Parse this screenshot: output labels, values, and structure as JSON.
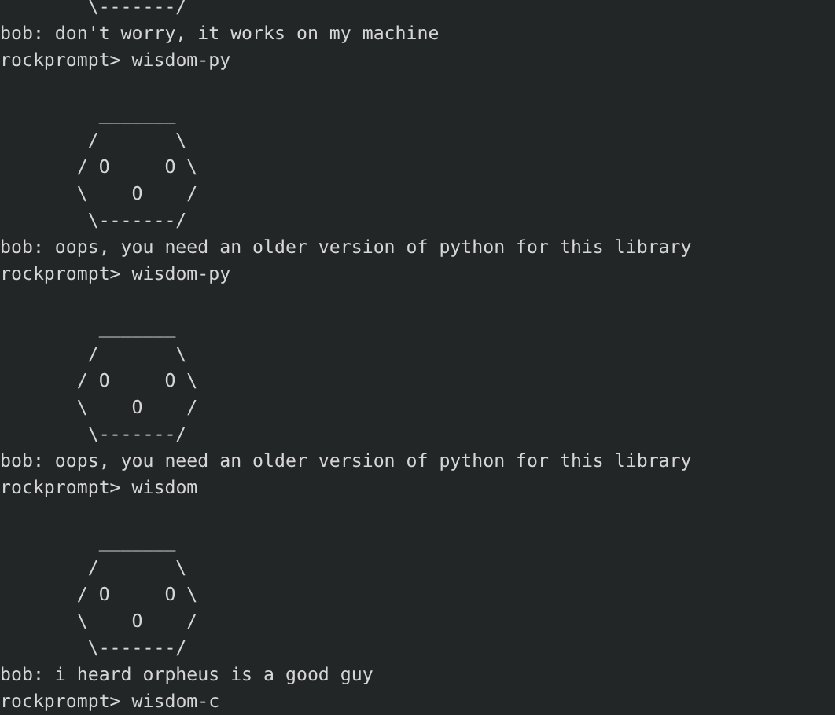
{
  "terminal": {
    "lines": [
      {
        "kind": "art",
        "lines": [
          "        \\-------/"
        ]
      },
      {
        "kind": "output",
        "text": "bob: don't worry, it works on my machine"
      },
      {
        "kind": "prompt",
        "prompt": "rockprompt>",
        "command": "wisdom-py"
      },
      {
        "kind": "blank"
      },
      {
        "kind": "art",
        "lines": [
          "         _______",
          "        /       \\",
          "       / O     O \\",
          "       \\    O    /",
          "        \\-------/"
        ]
      },
      {
        "kind": "output",
        "text": "bob: oops, you need an older version of python for this library"
      },
      {
        "kind": "prompt",
        "prompt": "rockprompt>",
        "command": "wisdom-py"
      },
      {
        "kind": "blank"
      },
      {
        "kind": "art",
        "lines": [
          "         _______",
          "        /       \\",
          "       / O     O \\",
          "       \\    O    /",
          "        \\-------/"
        ]
      },
      {
        "kind": "output",
        "text": "bob: oops, you need an older version of python for this library"
      },
      {
        "kind": "prompt",
        "prompt": "rockprompt>",
        "command": "wisdom"
      },
      {
        "kind": "blank"
      },
      {
        "kind": "art",
        "lines": [
          "         _______",
          "        /       \\",
          "       / O     O \\",
          "       \\    O    /",
          "        \\-------/"
        ]
      },
      {
        "kind": "output",
        "text": "bob: i heard orpheus is a good guy"
      },
      {
        "kind": "prompt",
        "prompt": "rockprompt>",
        "command": "wisdom-c"
      }
    ]
  }
}
